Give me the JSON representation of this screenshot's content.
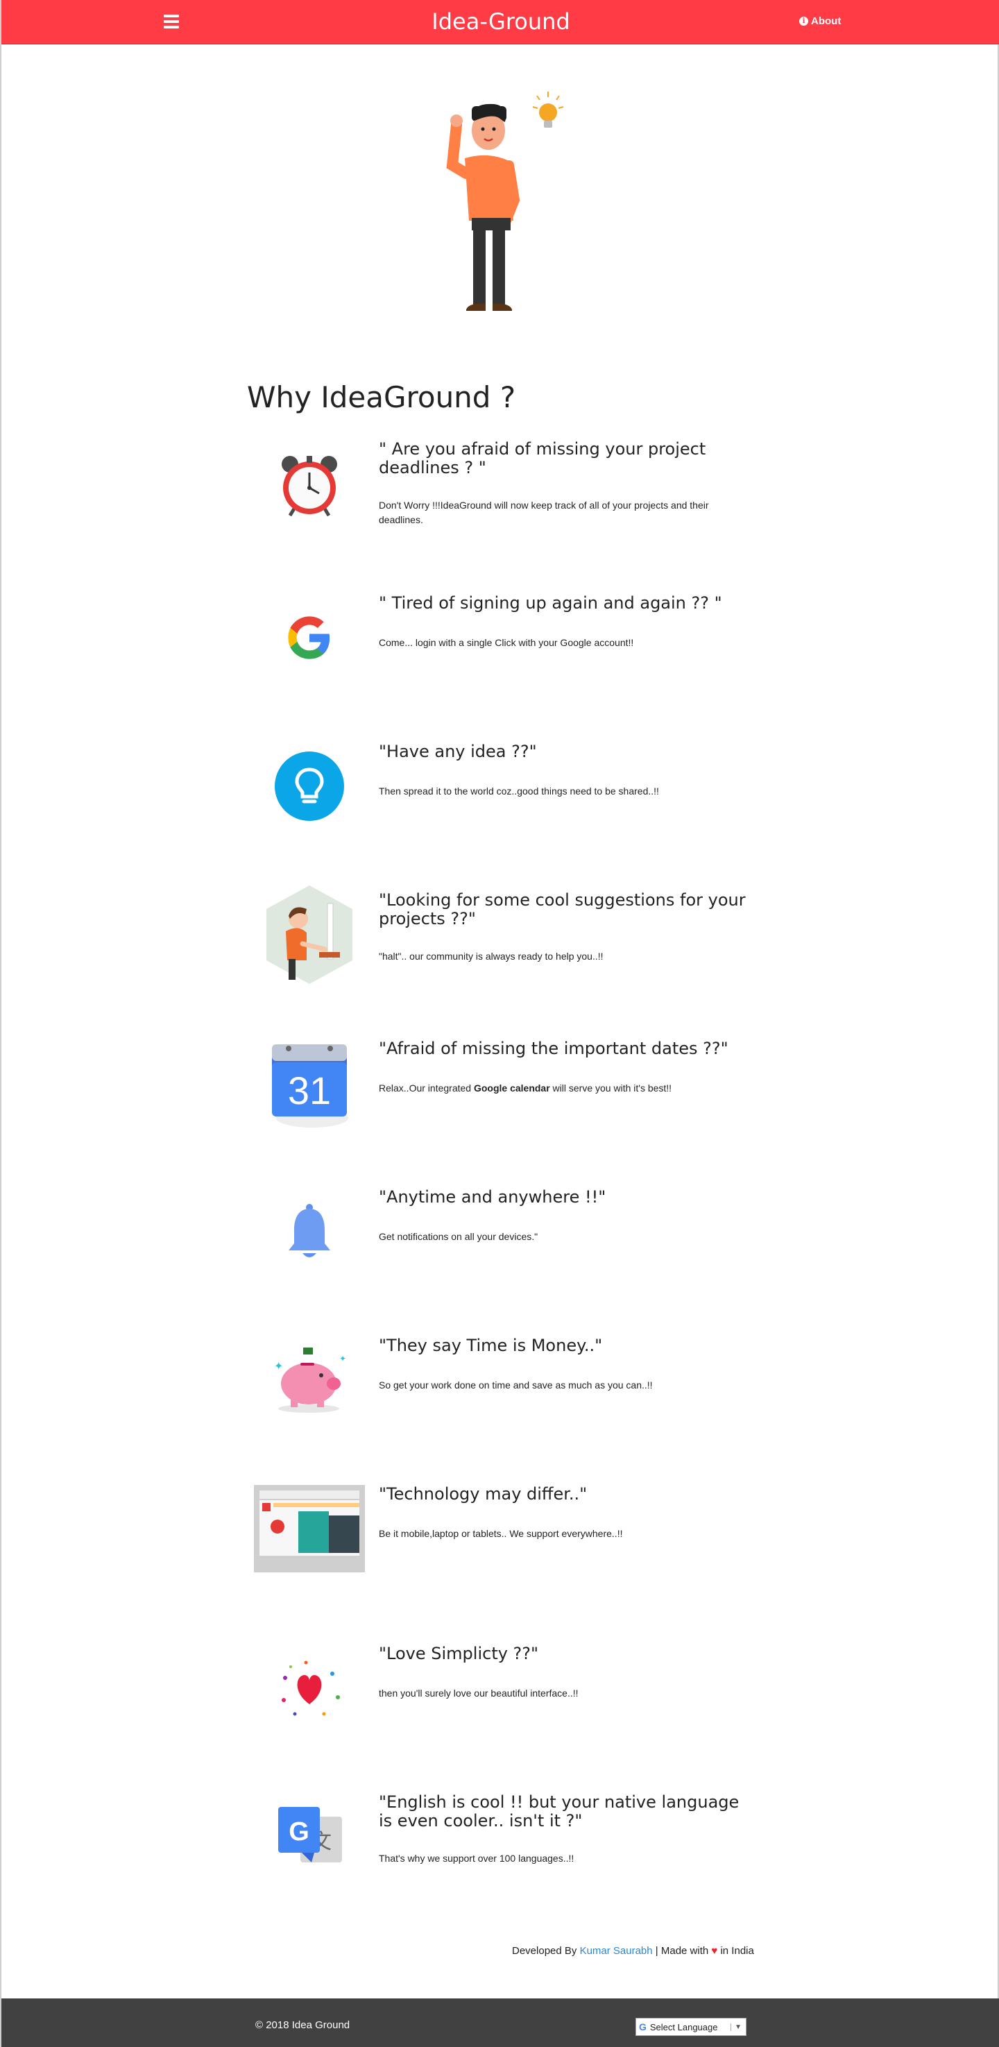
{
  "navbar": {
    "menu_icon": "hamburger-icon",
    "brand": "Idea-Ground",
    "about": "About",
    "about_icon": "info-circle-icon",
    "color": "#ff3b45"
  },
  "hero": {
    "image": "man-with-lightbulb-illustration"
  },
  "section_title": "Why IdeaGround ?",
  "features": [
    {
      "icon": "alarm-clock-icon",
      "title": "\" Are you afraid of missing your project deadlines ? \"",
      "desc": "Don't Worry !!!IdeaGround will now keep track of all of your projects and their deadlines."
    },
    {
      "icon": "google-icon",
      "title": "\" Tired of signing up again and again ?? \"",
      "desc": "Come... login with a single Click with your Google account!!"
    },
    {
      "icon": "lightbulb-icon",
      "title": "\"Have any idea ??\"",
      "desc": "Then spread it to the world coz..good things need to be shared..!!"
    },
    {
      "icon": "community-illustration-icon",
      "title": "\"Looking for some cool suggestions for your projects ??\"",
      "desc": "\"halt\".. our community is always ready to help you..!!"
    },
    {
      "icon": "google-calendar-icon",
      "title": "\"Afraid of missing the important dates ??\"",
      "desc_pre": "Relax..Our integrated ",
      "desc_bold": "Google calendar",
      "desc_post": " will serve you with it's best!!"
    },
    {
      "icon": "bell-icon",
      "title": "\"Anytime and anywhere !!\"",
      "desc": "Get notifications on all your devices.\""
    },
    {
      "icon": "piggy-bank-icon",
      "title": "\"They say Time is Money..\"",
      "desc": "So get your work done on time and save as much as you can..!!"
    },
    {
      "icon": "multi-device-screenshot-icon",
      "title": "\"Technology may differ..\"",
      "desc": "Be it mobile,laptop or tablets.. We support everywhere..!!"
    },
    {
      "icon": "heart-confetti-icon",
      "title": "\"Love Simplicty ??\"",
      "desc": "then you'll surely love our beautiful interface..!!"
    },
    {
      "icon": "google-translate-icon",
      "title": "\"English is cool !! but your native language is even cooler.. isn't it ?\"",
      "desc": "That's why we support over 100 languages..!!"
    }
  ],
  "credit": {
    "prefix": "Developed By ",
    "author": "Kumar Saurabh",
    "middle": " | Made with ",
    "heart": "♥",
    "suffix": " in India"
  },
  "footer": {
    "copyright": "© 2018 Idea Ground",
    "language_label": "Select Language",
    "language_icon": "google-g-icon",
    "caret": "▼",
    "color": "#414141"
  }
}
